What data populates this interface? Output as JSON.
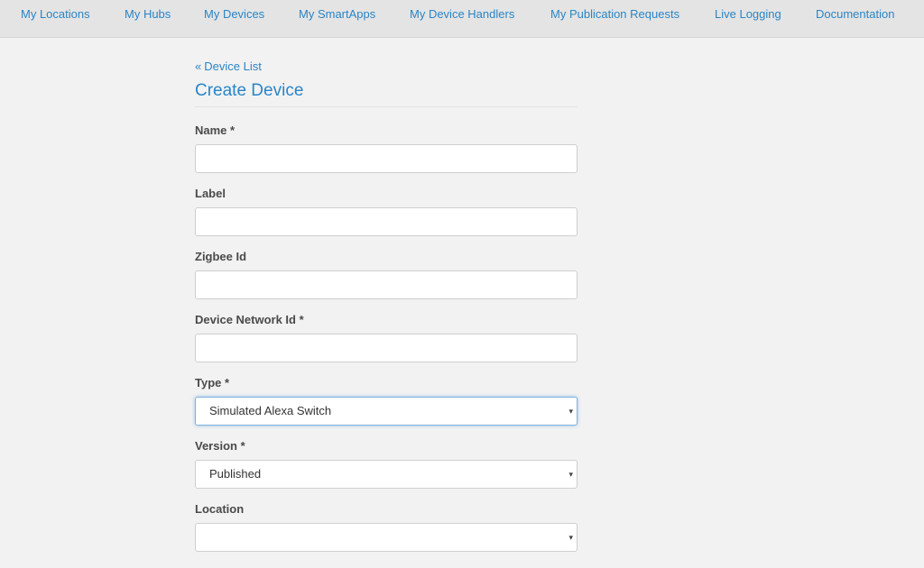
{
  "nav": {
    "items": [
      {
        "label": "My Locations"
      },
      {
        "label": "My Hubs"
      },
      {
        "label": "My Devices"
      },
      {
        "label": "My SmartApps"
      },
      {
        "label": "My Device Handlers"
      },
      {
        "label": "My Publication Requests"
      },
      {
        "label": "Live Logging"
      },
      {
        "label": "Documentation"
      }
    ]
  },
  "page": {
    "back_arrow": "«",
    "back_label": "Device List",
    "title": "Create Device"
  },
  "form": {
    "name": {
      "label": "Name *",
      "value": ""
    },
    "label": {
      "label": "Label",
      "value": ""
    },
    "zigbee": {
      "label": "Zigbee Id",
      "value": ""
    },
    "network": {
      "label": "Device Network Id *",
      "value": ""
    },
    "type": {
      "label": "Type *",
      "selected": "Simulated Alexa Switch"
    },
    "version": {
      "label": "Version *",
      "selected": "Published"
    },
    "location": {
      "label": "Location",
      "selected": ""
    }
  },
  "icons": {
    "caret": "▾"
  },
  "colors": {
    "accent": "#2a85c6",
    "nav_bg": "#e4e4e4",
    "page_bg": "#f2f2f2"
  }
}
